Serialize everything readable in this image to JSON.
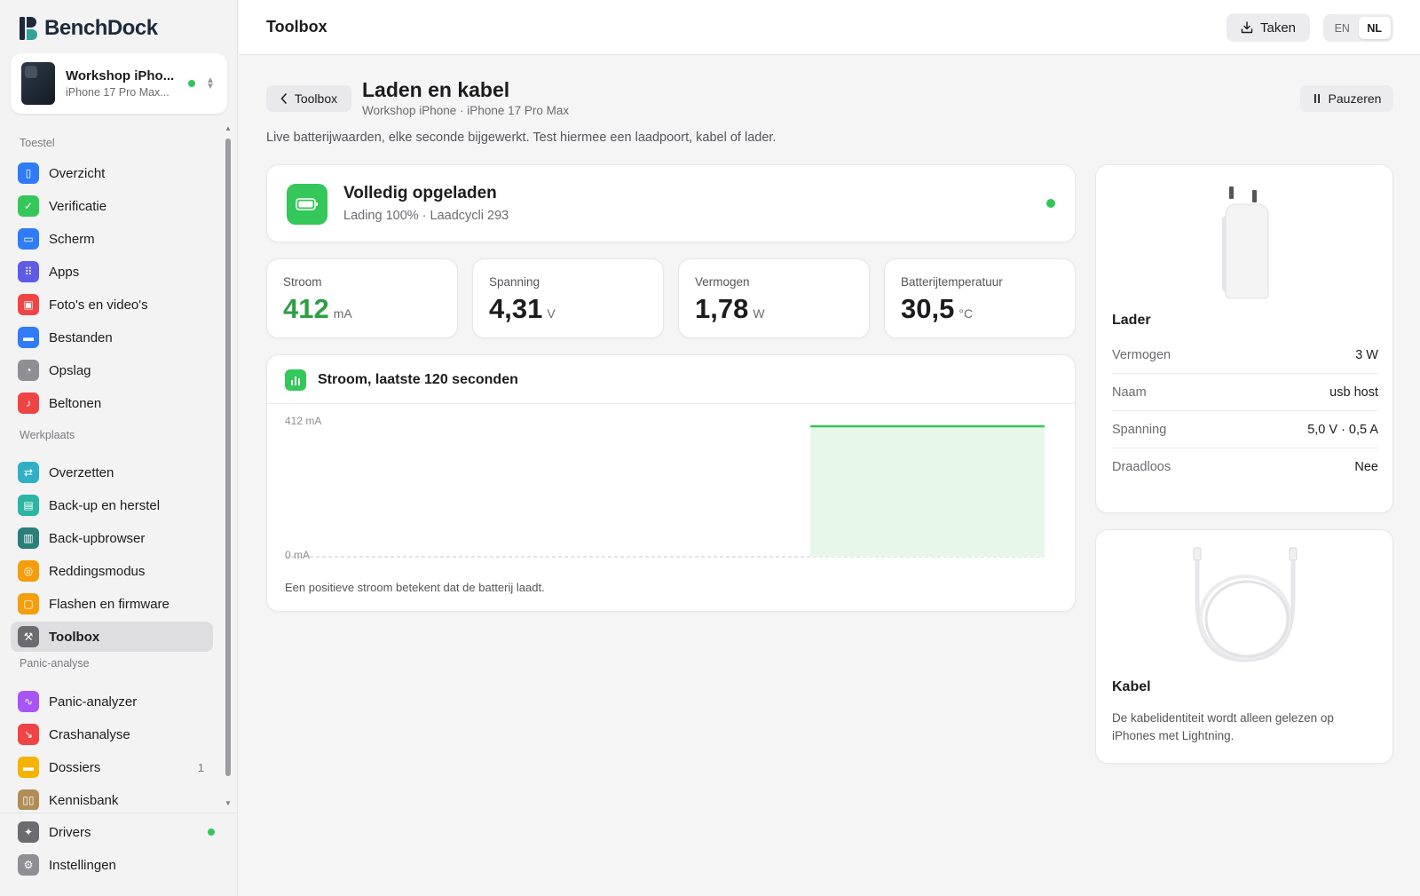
{
  "app": {
    "brand": "BenchDock"
  },
  "device": {
    "name": "Workshop iPho...",
    "model": "iPhone 17 Pro Max..."
  },
  "sidebar": {
    "sections": [
      "Toestel",
      "Werkplaats",
      "Panic-analyse"
    ],
    "items": [
      {
        "label": "Overzicht",
        "icon": "phone-icon",
        "color": "#2f7cf6"
      },
      {
        "label": "Verificatie",
        "icon": "shield-check-icon",
        "color": "#34c759"
      },
      {
        "label": "Scherm",
        "icon": "screen-icon",
        "color": "#2f7cf6"
      },
      {
        "label": "Apps",
        "icon": "apps-grid-icon",
        "color": "#5e5ce6"
      },
      {
        "label": "Foto's en video's",
        "icon": "photos-icon",
        "color": "#ef4444"
      },
      {
        "label": "Bestanden",
        "icon": "folder-icon",
        "color": "#2f7cf6"
      },
      {
        "label": "Opslag",
        "icon": "storage-pie-icon",
        "color": "#8e8e93"
      },
      {
        "label": "Beltonen",
        "icon": "music-note-icon",
        "color": "#ef4444"
      },
      {
        "label": "Overzetten",
        "icon": "transfer-arrows-icon",
        "color": "#30b0c7"
      },
      {
        "label": "Back-up en herstel",
        "icon": "archive-icon",
        "color": "#2bb5a3"
      },
      {
        "label": "Back-upbrowser",
        "icon": "tray-icon",
        "color": "#2a7f7a"
      },
      {
        "label": "Reddingsmodus",
        "icon": "lifebuoy-icon",
        "color": "#f59e0b"
      },
      {
        "label": "Flashen en firmware",
        "icon": "chip-icon",
        "color": "#f59e0b"
      },
      {
        "label": "Toolbox",
        "icon": "wrench-icon",
        "color": "#6b6b70"
      },
      {
        "label": "Panic-analyzer",
        "icon": "waveform-icon",
        "color": "#a855f7"
      },
      {
        "label": "Crashanalyse",
        "icon": "chart-down-icon",
        "color": "#ef4444"
      },
      {
        "label": "Dossiers",
        "icon": "folder-icon",
        "color": "#f5b301",
        "count": "1"
      },
      {
        "label": "Kennisbank",
        "icon": "book-icon",
        "color": "#b08d57"
      }
    ],
    "bottom": [
      {
        "label": "Drivers",
        "icon": "puzzle-icon",
        "color": "#6b6b70"
      },
      {
        "label": "Instellingen",
        "icon": "gear-icon",
        "color": "#8e8e93"
      }
    ]
  },
  "topbar": {
    "title": "Toolbox",
    "taken_label": "Taken",
    "lang_en": "EN",
    "lang_nl": "NL",
    "lang_selected": "NL"
  },
  "page": {
    "back_label": "Toolbox",
    "title": "Laden en kabel",
    "subtitle": "Workshop iPhone · iPhone 17 Pro Max",
    "pause_label": "Pauzeren",
    "intro": "Live batterijwaarden, elke seconde bijgewerkt. Test hiermee een laadpoort, kabel of lader."
  },
  "status": {
    "title": "Volledig opgeladen",
    "subtitle": "Lading 100% · Laadcycli 293"
  },
  "metrics": [
    {
      "label": "Stroom",
      "value": "412",
      "unit": "mA"
    },
    {
      "label": "Spanning",
      "value": "4,31",
      "unit": "V"
    },
    {
      "label": "Vermogen",
      "value": "1,78",
      "unit": "W"
    },
    {
      "label": "Batterijtemperatuur",
      "value": "30,5",
      "unit": "°C"
    }
  ],
  "chart": {
    "title": "Stroom, laatste 120 seconden",
    "note": "Een positieve stroom betekent dat de batterij laadt."
  },
  "chart_data": {
    "type": "area",
    "title": "Stroom, laatste 120 seconden",
    "y_unit": "mA",
    "y_tick_labels": [
      "412 mA",
      "0 mA"
    ],
    "ylim": [
      0,
      412
    ],
    "xlim": [
      0,
      120
    ],
    "series": [
      {
        "points": [
          [
            0,
            0
          ],
          [
            83,
            0
          ],
          [
            83,
            412
          ],
          [
            120,
            412
          ]
        ]
      }
    ],
    "line_color": "#34c759",
    "fill_color": "#e7f7ea"
  },
  "lader": {
    "title": "Lader",
    "rows": [
      {
        "key": "Vermogen",
        "value": "3 W"
      },
      {
        "key": "Naam",
        "value": "usb host"
      },
      {
        "key": "Spanning",
        "value": "5,0 V · 0,5 A"
      },
      {
        "key": "Draadloos",
        "value": "Nee"
      }
    ]
  },
  "kabel": {
    "title": "Kabel",
    "text": "De kabelidentiteit wordt alleen gelezen op iPhones met Lightning."
  }
}
